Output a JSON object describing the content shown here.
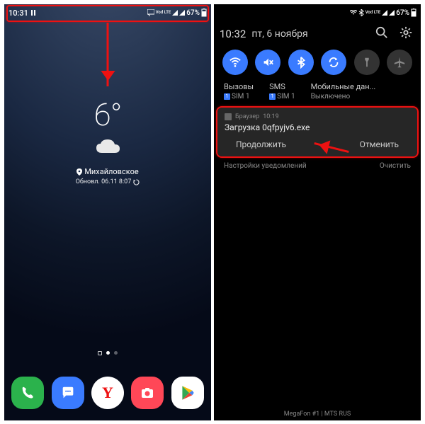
{
  "left": {
    "status": {
      "time": "10:31",
      "battery_pct": "67%",
      "network_label": "Vod LTE"
    },
    "weather": {
      "temp": "6°",
      "location": "Михайловское",
      "updated": "Обновл. 06.11 8:07"
    },
    "dock": [
      "Phone",
      "Messages",
      "Yandex",
      "Camera",
      "Play Store"
    ]
  },
  "right": {
    "status": {
      "battery_pct": "67%",
      "network_label": "Vod LTE"
    },
    "shade": {
      "time": "10:32",
      "date": "пт, 6 ноября"
    },
    "quick": {
      "wifi": true,
      "sound_mute": true,
      "bluetooth": true,
      "sync": true,
      "flashlight": false,
      "airplane": false
    },
    "sim": {
      "calls": {
        "label": "Вызовы",
        "value": "SIM 1"
      },
      "sms": {
        "label": "SMS",
        "value": "SIM 1"
      },
      "data": {
        "label": "Мобильные дан...",
        "value": "Выключено"
      }
    },
    "notif": {
      "app": "Браузер",
      "time": "10:19",
      "title": "Загрузка 0qfpyjv6.exe",
      "continue": "Продолжить",
      "cancel": "Отменить"
    },
    "footer": {
      "settings": "Настройки уведомлений",
      "clear": "Очистить"
    },
    "carrier": "MegaFon #1 | MTS RUS"
  }
}
